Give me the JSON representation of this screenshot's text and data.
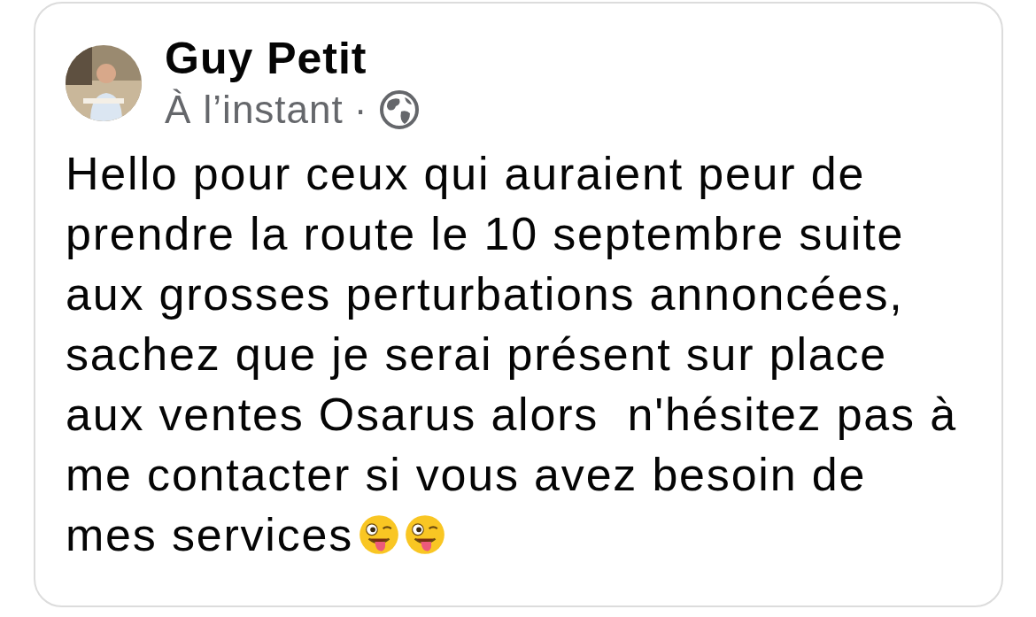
{
  "post": {
    "author": "Guy Petit",
    "time": "À l’instant",
    "separator": "·",
    "body_lines": [
      "Hello pour ceux qui auraient peur de",
      "prendre la route le 10 septembre suite",
      "aux grosses perturbations annoncées,",
      "sachez que je serai présent sur place",
      "aux ventes Osarus alors  n'hésitez pas à",
      "me contacter si vous avez besoin de",
      "mes services"
    ]
  }
}
